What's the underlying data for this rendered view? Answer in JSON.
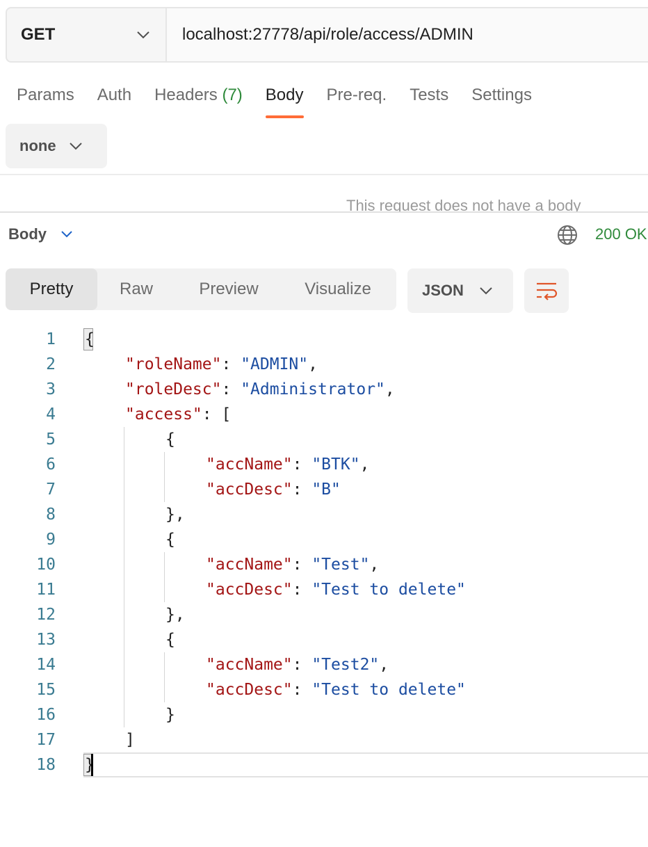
{
  "request": {
    "method": "GET",
    "url": "localhost:27778/api/role/access/ADMIN"
  },
  "request_tabs": [
    {
      "label": "Params"
    },
    {
      "label": "Auth"
    },
    {
      "label": "Headers",
      "count": "(7)"
    },
    {
      "label": "Body",
      "active": true
    },
    {
      "label": "Pre-req."
    },
    {
      "label": "Tests"
    },
    {
      "label": "Settings"
    }
  ],
  "body_type": {
    "value": "none"
  },
  "no_body_message": "This request does not have a body",
  "response": {
    "section_label": "Body",
    "status": "200 OK"
  },
  "view_modes": [
    "Pretty",
    "Raw",
    "Preview",
    "Visualize"
  ],
  "active_view_mode": "Pretty",
  "format": "JSON",
  "icons": {
    "method_dropdown": "chevron-down-icon",
    "body_dropdown": "chevron-down-icon",
    "globe": "globe-icon",
    "wrap": "wrap-lines-icon"
  },
  "colors": {
    "accent": "#ff6c37",
    "status_ok": "#2f8a3b",
    "json_key": "#a31515",
    "json_string": "#1c4da1",
    "line_number": "#3a7b91"
  },
  "code_lines": [
    {
      "n": "1",
      "indent": 0,
      "tokens": [
        [
          "p",
          "{"
        ]
      ]
    },
    {
      "n": "2",
      "indent": 1,
      "tokens": [
        [
          "k",
          "\"roleName\""
        ],
        [
          "p",
          ": "
        ],
        [
          "s",
          "\"ADMIN\""
        ],
        [
          "p",
          ","
        ]
      ]
    },
    {
      "n": "3",
      "indent": 1,
      "tokens": [
        [
          "k",
          "\"roleDesc\""
        ],
        [
          "p",
          ": "
        ],
        [
          "s",
          "\"Administrator\""
        ],
        [
          "p",
          ","
        ]
      ]
    },
    {
      "n": "4",
      "indent": 1,
      "tokens": [
        [
          "k",
          "\"access\""
        ],
        [
          "p",
          ": ["
        ]
      ]
    },
    {
      "n": "5",
      "indent": 2,
      "tokens": [
        [
          "p",
          "{"
        ]
      ]
    },
    {
      "n": "6",
      "indent": 3,
      "tokens": [
        [
          "k",
          "\"accName\""
        ],
        [
          "p",
          ": "
        ],
        [
          "s",
          "\"BTK\""
        ],
        [
          "p",
          ","
        ]
      ]
    },
    {
      "n": "7",
      "indent": 3,
      "tokens": [
        [
          "k",
          "\"accDesc\""
        ],
        [
          "p",
          ": "
        ],
        [
          "s",
          "\"B\""
        ]
      ]
    },
    {
      "n": "8",
      "indent": 2,
      "tokens": [
        [
          "p",
          "},"
        ]
      ]
    },
    {
      "n": "9",
      "indent": 2,
      "tokens": [
        [
          "p",
          "{"
        ]
      ]
    },
    {
      "n": "10",
      "indent": 3,
      "tokens": [
        [
          "k",
          "\"accName\""
        ],
        [
          "p",
          ": "
        ],
        [
          "s",
          "\"Test\""
        ],
        [
          "p",
          ","
        ]
      ]
    },
    {
      "n": "11",
      "indent": 3,
      "tokens": [
        [
          "k",
          "\"accDesc\""
        ],
        [
          "p",
          ": "
        ],
        [
          "s",
          "\"Test to delete\""
        ]
      ]
    },
    {
      "n": "12",
      "indent": 2,
      "tokens": [
        [
          "p",
          "},"
        ]
      ]
    },
    {
      "n": "13",
      "indent": 2,
      "tokens": [
        [
          "p",
          "{"
        ]
      ]
    },
    {
      "n": "14",
      "indent": 3,
      "tokens": [
        [
          "k",
          "\"accName\""
        ],
        [
          "p",
          ": "
        ],
        [
          "s",
          "\"Test2\""
        ],
        [
          "p",
          ","
        ]
      ]
    },
    {
      "n": "15",
      "indent": 3,
      "tokens": [
        [
          "k",
          "\"accDesc\""
        ],
        [
          "p",
          ": "
        ],
        [
          "s",
          "\"Test to delete\""
        ]
      ]
    },
    {
      "n": "16",
      "indent": 2,
      "tokens": [
        [
          "p",
          "}"
        ]
      ]
    },
    {
      "n": "17",
      "indent": 1,
      "tokens": [
        [
          "p",
          "]"
        ]
      ]
    },
    {
      "n": "18",
      "indent": 0,
      "tokens": [
        [
          "p",
          "}"
        ]
      ]
    }
  ]
}
